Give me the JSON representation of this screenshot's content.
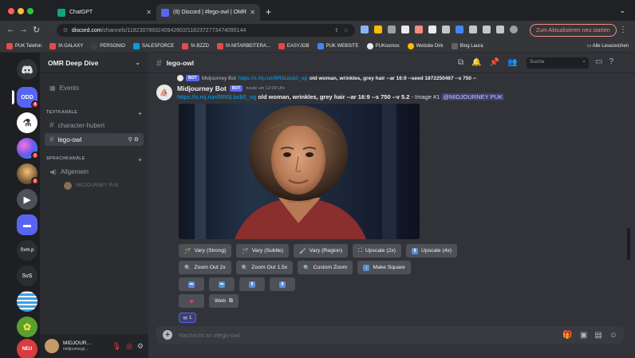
{
  "browser": {
    "tabs": [
      {
        "title": "ChatGPT",
        "active": false,
        "favicon_color": "#10a37f"
      },
      {
        "title": "(8) Discord | #lego-owl | OMR",
        "active": true,
        "favicon_color": "#5865f2"
      }
    ],
    "url_host": "discord.com",
    "url_path": "/channels/1182307893240942602/1182372773474095144",
    "update_button": "Zum Aktualisieren neu starten",
    "bookmarks": [
      {
        "label": "PUK Telefon",
        "color": "#e8eaed"
      },
      {
        "label": "fA GALAXY",
        "color": "#e54b4b"
      },
      {
        "label": "PERSONIO",
        "color": "#ffffff"
      },
      {
        "label": "SALESFORCE",
        "color": "#00a1e0"
      },
      {
        "label": "fA BZZD",
        "color": "#e54b4b"
      },
      {
        "label": "fA MITARBEITERA...",
        "color": "#e54b4b"
      },
      {
        "label": "EASYJOB",
        "color": "#e8453c"
      },
      {
        "label": "PUK WEBSITE",
        "color": "#4285f4"
      },
      {
        "label": "PUKosmos",
        "color": "#9aa0a6"
      },
      {
        "label": "Website Dirk",
        "color": "#fbbc04"
      },
      {
        "label": "Blog Laura",
        "color": "#9aa0a6"
      }
    ],
    "all_bookmarks": "Alle Lesezeichen"
  },
  "discord": {
    "server_name": "OMR Deep Dive",
    "events_label": "Events",
    "categories": {
      "text": "TEXTKANÄLE",
      "voice": "SPRACHKANÄLE"
    },
    "channels": [
      "character-hubert",
      "lego-owl"
    ],
    "voice_channel": "Allgemein",
    "voice_user": "MIDJOURNEY PUK",
    "guilds": [
      {
        "label": "",
        "color": "#313338",
        "badge": ""
      },
      {
        "label": "ODD",
        "color": "#5865f2",
        "badge": "4"
      },
      {
        "label": "",
        "color": "#ffffff",
        "badge": ""
      },
      {
        "label": "",
        "color": "#7b5cf0",
        "badge": "1"
      },
      {
        "label": "",
        "color": "#6b4e2e",
        "badge": "1"
      },
      {
        "label": "",
        "color": "#4e5058",
        "badge": ""
      },
      {
        "label": "",
        "color": "#5865f2",
        "badge": ""
      },
      {
        "label": "Svm.p",
        "color": "#2b2d31",
        "badge": ""
      },
      {
        "label": "SvS",
        "color": "#2b2d31",
        "badge": ""
      },
      {
        "label": "",
        "color": "#3aa0e6",
        "badge": ""
      },
      {
        "label": "",
        "color": "#5aa02c",
        "badge": ""
      },
      {
        "label": "NEU",
        "color": "#d83c3e",
        "badge": ""
      }
    ],
    "user": {
      "name": "MIDJOUR...",
      "status": "midjourneyp..."
    },
    "channel_title": "lego-owl",
    "search_placeholder": "Suche",
    "reply": {
      "author": "Midjourney Bot",
      "link": "https://s.mj.run/RR0Lbcb0_og",
      "text": "old woman, wrinkles, grey hair --ar 16:9 --seed 1872250467 --s 750 --"
    },
    "message": {
      "author": "Midjourney Bot",
      "bot_tag": "BOT",
      "timestamp": "heute um 12:09 Uhr",
      "link": "https://s.mj.run/RR0Lbcb0_og",
      "prompt": "old woman, wrinkles, grey hair --ar 16:9 --s 750 --v 5.2",
      "suffix": " - Image #1 ",
      "mention": "@MIDJOURNEY PUK"
    },
    "buttons_row1": [
      "Vary (Strong)",
      "Vary (Subtle)",
      "Vary (Region)",
      "Upscale (2x)",
      "Upscale (4x)"
    ],
    "buttons_row2": [
      "Zoom Out 2x",
      "Zoom Out 1.5x",
      "Custom Zoom",
      "Make Square"
    ],
    "arrows": [
      "⬅",
      "➡",
      "⬆",
      "⬇"
    ],
    "web_label": "Web",
    "reaction_count": "1",
    "composer_placeholder": "Nachricht an #lego-owl"
  }
}
